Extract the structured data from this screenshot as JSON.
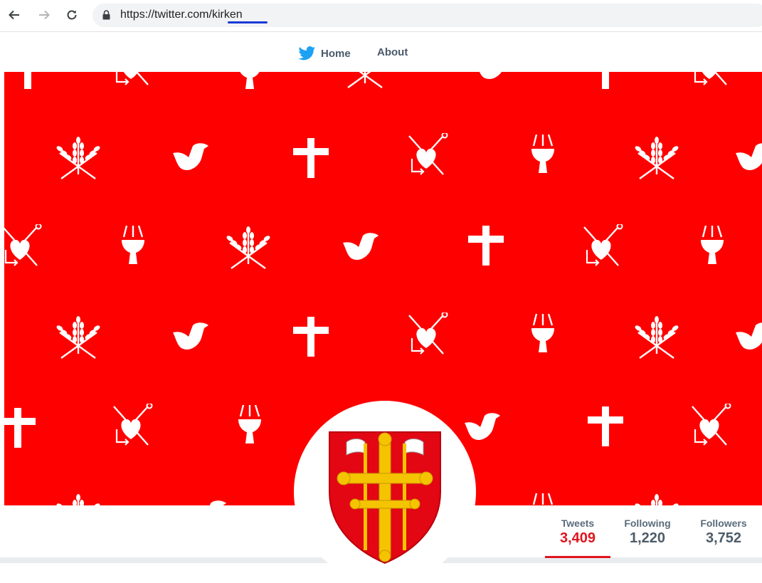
{
  "browser": {
    "url_host": "https://twitter.com/",
    "url_path": "kirken"
  },
  "nav": {
    "home_label": "Home",
    "about_label": "About"
  },
  "banner": {
    "background_color": "#ff0000",
    "symbols": [
      "wheat-cross-icon",
      "dove-icon",
      "cross-icon",
      "heart-anchor-icon",
      "chalice-icon"
    ]
  },
  "avatar": {
    "name": "church-coat-of-arms-icon",
    "shield_color": "#e30613",
    "cross_color": "#f5c400"
  },
  "stats": [
    {
      "label": "Tweets",
      "value": "3,409"
    },
    {
      "label": "Following",
      "value": "1,220"
    },
    {
      "label": "Followers",
      "value": "3,752"
    }
  ]
}
